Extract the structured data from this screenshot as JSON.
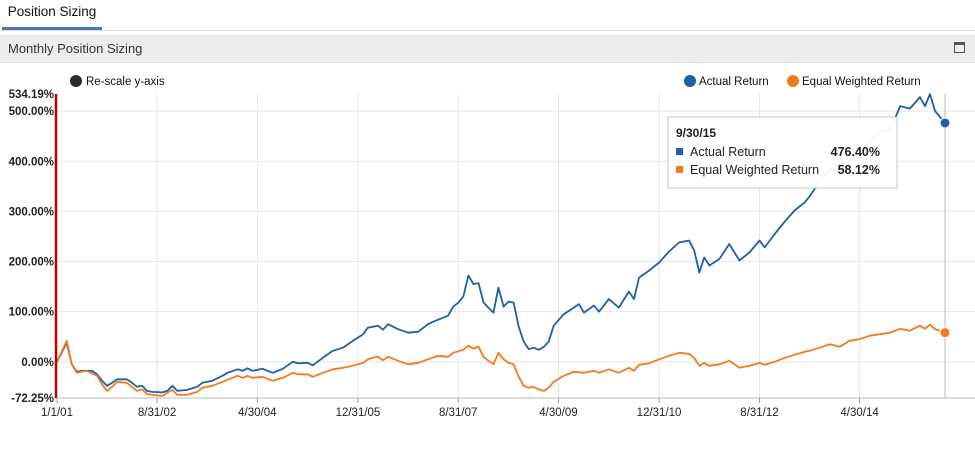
{
  "tab": {
    "label": "Position Sizing"
  },
  "panel": {
    "title": "Monthly Position Sizing"
  },
  "rescale": {
    "label": "Re-scale y-axis"
  },
  "colors": {
    "actual": "#1f5fa7",
    "equal": "#f57a1f",
    "marker": "#c00000",
    "hover": "#b8b8b8",
    "grid": "#e6e6e6"
  },
  "tooltip": {
    "date": "9/30/15",
    "rows": [
      {
        "label": "Actual Return",
        "value": "476.40%"
      },
      {
        "label": "Equal Weighted Return",
        "value": "58.12%"
      }
    ]
  },
  "chart_data": {
    "type": "line",
    "x_start": "2001-01-01",
    "x_end": "2015-09-30",
    "ylim": [
      -72.25,
      534.19
    ],
    "y_ticks": [
      {
        "v": 534.19,
        "label": "534.19%"
      },
      {
        "v": 500,
        "label": "500.00%"
      },
      {
        "v": 400,
        "label": "400.00%"
      },
      {
        "v": 300,
        "label": "300.00%"
      },
      {
        "v": 200,
        "label": "200.00%"
      },
      {
        "v": 100,
        "label": "100.00%"
      },
      {
        "v": 0,
        "label": "0.00%"
      },
      {
        "v": -72.25,
        "label": "-72.25%"
      }
    ],
    "x_ticks": [
      {
        "d": "2001-01-01",
        "label": "1/1/01"
      },
      {
        "d": "2002-08-31",
        "label": "8/31/02"
      },
      {
        "d": "2004-04-30",
        "label": "4/30/04"
      },
      {
        "d": "2005-12-31",
        "label": "12/31/05"
      },
      {
        "d": "2007-08-31",
        "label": "8/31/07"
      },
      {
        "d": "2009-04-30",
        "label": "4/30/09"
      },
      {
        "d": "2010-12-31",
        "label": "12/31/10"
      },
      {
        "d": "2012-08-31",
        "label": "8/31/12"
      },
      {
        "d": "2014-04-30",
        "label": "4/30/14"
      }
    ],
    "grid": true,
    "legend_position": "top-right",
    "hover_date": "2015-09-30",
    "series": [
      {
        "name": "Actual Return",
        "points": [
          [
            "2001-01-01",
            0
          ],
          [
            "2001-03-01",
            38
          ],
          [
            "2001-04-01",
            -5
          ],
          [
            "2001-05-01",
            -20
          ],
          [
            "2001-06-01",
            -18
          ],
          [
            "2001-08-01",
            -18
          ],
          [
            "2001-09-01",
            -25
          ],
          [
            "2001-10-01",
            -38
          ],
          [
            "2001-11-01",
            -48
          ],
          [
            "2001-12-01",
            -42
          ],
          [
            "2002-01-01",
            -35
          ],
          [
            "2002-03-01",
            -35
          ],
          [
            "2002-04-01",
            -42
          ],
          [
            "2002-05-01",
            -50
          ],
          [
            "2002-06-01",
            -48
          ],
          [
            "2002-07-01",
            -58
          ],
          [
            "2002-08-01",
            -60
          ],
          [
            "2002-10-01",
            -61
          ],
          [
            "2002-11-01",
            -58
          ],
          [
            "2002-12-01",
            -48
          ],
          [
            "2003-01-01",
            -58
          ],
          [
            "2003-03-01",
            -56
          ],
          [
            "2003-05-01",
            -50
          ],
          [
            "2003-06-01",
            -42
          ],
          [
            "2003-08-01",
            -38
          ],
          [
            "2003-10-01",
            -28
          ],
          [
            "2003-11-01",
            -22
          ],
          [
            "2004-01-01",
            -15
          ],
          [
            "2004-02-01",
            -18
          ],
          [
            "2004-03-01",
            -13
          ],
          [
            "2004-04-01",
            -18
          ],
          [
            "2004-06-01",
            -14
          ],
          [
            "2004-08-01",
            -22
          ],
          [
            "2004-10-01",
            -14
          ],
          [
            "2004-12-01",
            0
          ],
          [
            "2005-01-01",
            -3
          ],
          [
            "2005-03-01",
            -2
          ],
          [
            "2005-04-01",
            -7
          ],
          [
            "2005-06-01",
            8
          ],
          [
            "2005-08-01",
            22
          ],
          [
            "2005-10-01",
            28
          ],
          [
            "2005-12-01",
            42
          ],
          [
            "2006-02-01",
            55
          ],
          [
            "2006-03-01",
            68
          ],
          [
            "2006-04-01",
            70
          ],
          [
            "2006-05-01",
            72
          ],
          [
            "2006-06-01",
            64
          ],
          [
            "2006-07-01",
            75
          ],
          [
            "2006-09-01",
            65
          ],
          [
            "2006-11-01",
            58
          ],
          [
            "2007-01-01",
            60
          ],
          [
            "2007-03-01",
            75
          ],
          [
            "2007-04-01",
            80
          ],
          [
            "2007-06-01",
            88
          ],
          [
            "2007-07-01",
            92
          ],
          [
            "2007-08-01",
            110
          ],
          [
            "2007-09-01",
            118
          ],
          [
            "2007-10-01",
            130
          ],
          [
            "2007-11-01",
            172
          ],
          [
            "2007-12-01",
            155
          ],
          [
            "2008-01-01",
            157
          ],
          [
            "2008-02-01",
            118
          ],
          [
            "2008-03-01",
            108
          ],
          [
            "2008-04-01",
            98
          ],
          [
            "2008-05-01",
            148
          ],
          [
            "2008-06-01",
            110
          ],
          [
            "2008-07-01",
            120
          ],
          [
            "2008-08-01",
            118
          ],
          [
            "2008-09-01",
            70
          ],
          [
            "2008-10-01",
            40
          ],
          [
            "2008-11-01",
            25
          ],
          [
            "2008-12-01",
            28
          ],
          [
            "2009-01-01",
            24
          ],
          [
            "2009-02-01",
            30
          ],
          [
            "2009-03-01",
            40
          ],
          [
            "2009-04-01",
            72
          ],
          [
            "2009-06-01",
            95
          ],
          [
            "2009-08-01",
            108
          ],
          [
            "2009-09-01",
            115
          ],
          [
            "2009-10-01",
            98
          ],
          [
            "2009-12-01",
            112
          ],
          [
            "2010-01-01",
            100
          ],
          [
            "2010-03-01",
            125
          ],
          [
            "2010-05-01",
            108
          ],
          [
            "2010-07-01",
            140
          ],
          [
            "2010-08-01",
            125
          ],
          [
            "2010-09-01",
            168
          ],
          [
            "2010-11-01",
            182
          ],
          [
            "2011-01-01",
            198
          ],
          [
            "2011-03-01",
            220
          ],
          [
            "2011-05-01",
            238
          ],
          [
            "2011-07-01",
            242
          ],
          [
            "2011-08-01",
            222
          ],
          [
            "2011-09-01",
            178
          ],
          [
            "2011-10-01",
            208
          ],
          [
            "2011-11-01",
            192
          ],
          [
            "2012-01-01",
            205
          ],
          [
            "2012-03-01",
            235
          ],
          [
            "2012-05-01",
            202
          ],
          [
            "2012-07-01",
            218
          ],
          [
            "2012-09-01",
            242
          ],
          [
            "2012-10-01",
            228
          ],
          [
            "2012-12-01",
            255
          ],
          [
            "2013-02-01",
            280
          ],
          [
            "2013-04-01",
            302
          ],
          [
            "2013-06-01",
            318
          ],
          [
            "2013-07-01",
            330
          ],
          [
            "2013-09-01",
            360
          ],
          [
            "2013-11-01",
            385
          ],
          [
            "2014-01-01",
            380
          ],
          [
            "2014-03-01",
            400
          ],
          [
            "2014-05-01",
            415
          ],
          [
            "2014-07-01",
            440
          ],
          [
            "2014-09-01",
            460
          ],
          [
            "2014-11-01",
            462
          ],
          [
            "2015-01-01",
            510
          ],
          [
            "2015-03-01",
            505
          ],
          [
            "2015-05-01",
            528
          ],
          [
            "2015-06-01",
            510
          ],
          [
            "2015-07-01",
            534
          ],
          [
            "2015-08-01",
            500
          ],
          [
            "2015-09-30",
            476.4
          ]
        ]
      },
      {
        "name": "Equal Weighted Return",
        "points": [
          [
            "2001-01-01",
            0
          ],
          [
            "2001-03-01",
            42
          ],
          [
            "2001-04-01",
            -5
          ],
          [
            "2001-05-01",
            -22
          ],
          [
            "2001-07-01",
            -18
          ],
          [
            "2001-09-01",
            -28
          ],
          [
            "2001-10-01",
            -45
          ],
          [
            "2001-11-01",
            -58
          ],
          [
            "2001-12-01",
            -50
          ],
          [
            "2002-01-01",
            -40
          ],
          [
            "2002-03-01",
            -42
          ],
          [
            "2002-04-01",
            -50
          ],
          [
            "2002-05-01",
            -58
          ],
          [
            "2002-06-01",
            -55
          ],
          [
            "2002-07-01",
            -64
          ],
          [
            "2002-08-01",
            -66
          ],
          [
            "2002-10-01",
            -68
          ],
          [
            "2002-11-01",
            -62
          ],
          [
            "2002-12-01",
            -56
          ],
          [
            "2003-01-01",
            -66
          ],
          [
            "2003-03-01",
            -66
          ],
          [
            "2003-05-01",
            -60
          ],
          [
            "2003-06-01",
            -52
          ],
          [
            "2003-08-01",
            -48
          ],
          [
            "2003-10-01",
            -40
          ],
          [
            "2003-11-01",
            -36
          ],
          [
            "2004-01-01",
            -28
          ],
          [
            "2004-02-01",
            -32
          ],
          [
            "2004-03-01",
            -28
          ],
          [
            "2004-04-01",
            -32
          ],
          [
            "2004-06-01",
            -30
          ],
          [
            "2004-08-01",
            -38
          ],
          [
            "2004-10-01",
            -32
          ],
          [
            "2004-12-01",
            -22
          ],
          [
            "2005-01-01",
            -25
          ],
          [
            "2005-03-01",
            -25
          ],
          [
            "2005-04-01",
            -30
          ],
          [
            "2005-06-01",
            -22
          ],
          [
            "2005-08-01",
            -15
          ],
          [
            "2005-10-01",
            -12
          ],
          [
            "2005-12-01",
            -8
          ],
          [
            "2006-02-01",
            -2
          ],
          [
            "2006-03-01",
            5
          ],
          [
            "2006-04-01",
            8
          ],
          [
            "2006-05-01",
            10
          ],
          [
            "2006-06-01",
            3
          ],
          [
            "2006-07-01",
            10
          ],
          [
            "2006-09-01",
            2
          ],
          [
            "2006-11-01",
            -5
          ],
          [
            "2007-01-01",
            -2
          ],
          [
            "2007-03-01",
            5
          ],
          [
            "2007-05-01",
            12
          ],
          [
            "2007-07-01",
            10
          ],
          [
            "2007-08-01",
            18
          ],
          [
            "2007-10-01",
            24
          ],
          [
            "2007-11-01",
            32
          ],
          [
            "2007-12-01",
            26
          ],
          [
            "2008-01-01",
            30
          ],
          [
            "2008-02-01",
            10
          ],
          [
            "2008-03-01",
            2
          ],
          [
            "2008-04-01",
            -5
          ],
          [
            "2008-05-01",
            18
          ],
          [
            "2008-06-01",
            5
          ],
          [
            "2008-07-01",
            -2
          ],
          [
            "2008-08-01",
            -5
          ],
          [
            "2008-09-01",
            -30
          ],
          [
            "2008-10-01",
            -48
          ],
          [
            "2008-11-01",
            -52
          ],
          [
            "2008-12-01",
            -50
          ],
          [
            "2009-01-01",
            -55
          ],
          [
            "2009-02-01",
            -58
          ],
          [
            "2009-03-01",
            -52
          ],
          [
            "2009-04-01",
            -40
          ],
          [
            "2009-06-01",
            -28
          ],
          [
            "2009-08-01",
            -20
          ],
          [
            "2009-10-01",
            -22
          ],
          [
            "2009-12-01",
            -18
          ],
          [
            "2010-01-01",
            -22
          ],
          [
            "2010-03-01",
            -15
          ],
          [
            "2010-05-01",
            -22
          ],
          [
            "2010-07-01",
            -12
          ],
          [
            "2010-08-01",
            -18
          ],
          [
            "2010-09-01",
            -6
          ],
          [
            "2010-11-01",
            -3
          ],
          [
            "2011-01-01",
            5
          ],
          [
            "2011-03-01",
            12
          ],
          [
            "2011-05-01",
            18
          ],
          [
            "2011-07-01",
            16
          ],
          [
            "2011-08-01",
            8
          ],
          [
            "2011-09-01",
            -8
          ],
          [
            "2011-10-01",
            -2
          ],
          [
            "2011-11-01",
            -8
          ],
          [
            "2012-01-01",
            -5
          ],
          [
            "2012-03-01",
            2
          ],
          [
            "2012-05-01",
            -12
          ],
          [
            "2012-07-01",
            -8
          ],
          [
            "2012-09-01",
            -2
          ],
          [
            "2012-10-01",
            -6
          ],
          [
            "2012-12-01",
            0
          ],
          [
            "2013-02-01",
            8
          ],
          [
            "2013-04-01",
            14
          ],
          [
            "2013-06-01",
            20
          ],
          [
            "2013-07-01",
            22
          ],
          [
            "2013-09-01",
            28
          ],
          [
            "2013-11-01",
            35
          ],
          [
            "2014-01-01",
            30
          ],
          [
            "2014-03-01",
            42
          ],
          [
            "2014-05-01",
            45
          ],
          [
            "2014-07-01",
            52
          ],
          [
            "2014-09-01",
            55
          ],
          [
            "2014-11-01",
            58
          ],
          [
            "2015-01-01",
            66
          ],
          [
            "2015-03-01",
            62
          ],
          [
            "2015-05-01",
            72
          ],
          [
            "2015-06-01",
            66
          ],
          [
            "2015-07-01",
            74
          ],
          [
            "2015-08-01",
            65
          ],
          [
            "2015-09-30",
            58.12
          ]
        ]
      }
    ]
  }
}
